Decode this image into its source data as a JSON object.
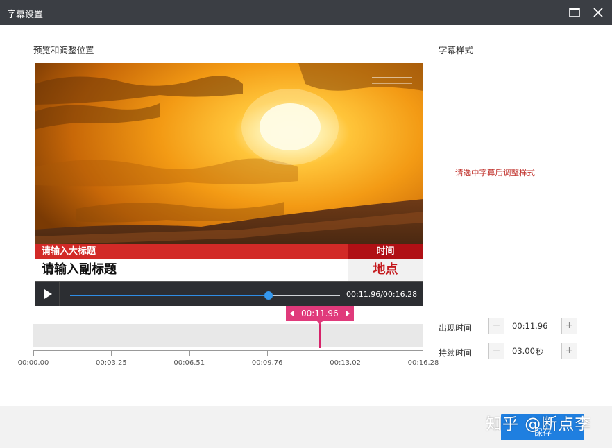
{
  "window": {
    "title": "字幕设置"
  },
  "preview_section": {
    "label": "预览和调整位置"
  },
  "style_section": {
    "label": "字幕样式",
    "hint": "请选中字幕后调整样式"
  },
  "subtitle_overlay": {
    "main_title": "请输入大标题",
    "sub_title": "请输入副标题",
    "time_label": "时间",
    "place_label": "地点"
  },
  "player": {
    "time_readout": "00:11.96/00:16.28",
    "progress_fraction": 0.7346
  },
  "timeline": {
    "cursor_time": "00:11.96",
    "cursor_fraction": 0.7346,
    "ticks": [
      "00:00.00",
      "00:03.25",
      "00:06.51",
      "00:09.76",
      "00:13.02",
      "00:16.28"
    ]
  },
  "fields": {
    "appear_label": "出现时间",
    "appear_value": "00:11.96",
    "duration_label": "持续时间",
    "duration_value": "03.00",
    "duration_unit": "秒",
    "minus": "−",
    "plus": "+"
  },
  "footer": {
    "save_label": "保存",
    "watermark": "知乎 @断点李"
  },
  "colors": {
    "titlebar": "#3b3e44",
    "accent_blue": "#1f7fe0",
    "cursor_pink": "#e03a7b",
    "hint_red": "#c0312b"
  }
}
